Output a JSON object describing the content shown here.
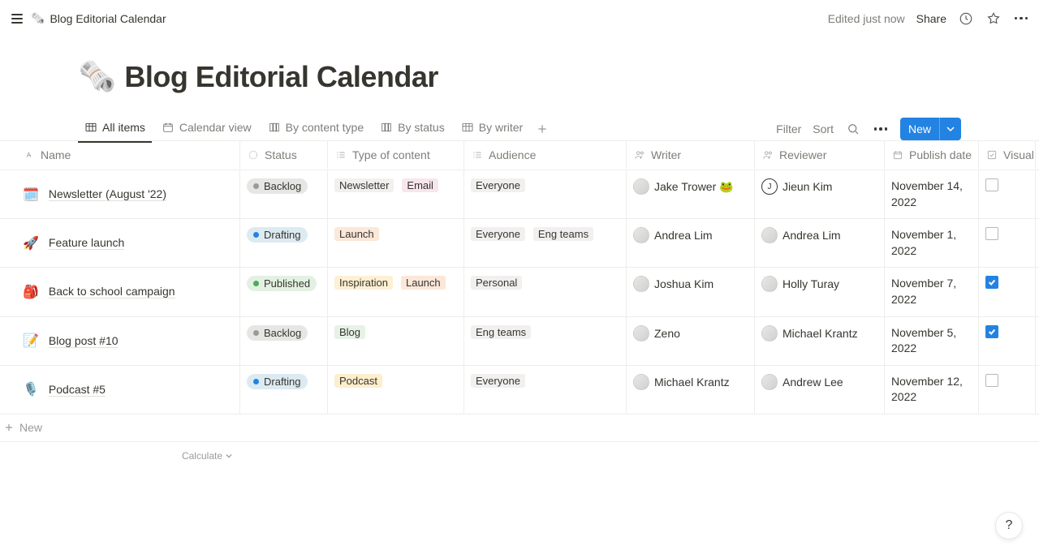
{
  "topbar": {
    "crumb_emoji": "🗞️",
    "crumb_title": "Blog Editorial Calendar",
    "edited": "Edited just now",
    "share": "Share"
  },
  "page": {
    "emoji": "🗞️",
    "title": "Blog Editorial Calendar"
  },
  "views": {
    "items": [
      {
        "label": "All items",
        "active": true
      },
      {
        "label": "Calendar view",
        "active": false
      },
      {
        "label": "By content type",
        "active": false
      },
      {
        "label": "By status",
        "active": false
      },
      {
        "label": "By writer",
        "active": false
      }
    ],
    "filter": "Filter",
    "sort": "Sort",
    "new": "New"
  },
  "columns": {
    "name": "Name",
    "status": "Status",
    "type": "Type of content",
    "audience": "Audience",
    "writer": "Writer",
    "reviewer": "Reviewer",
    "publish": "Publish date",
    "visual": "Visual"
  },
  "rows": [
    {
      "emoji": "🗓️",
      "name": "Newsletter (August '22)",
      "status": {
        "label": "Backlog",
        "tone": "gray"
      },
      "types": [
        {
          "label": "Newsletter",
          "tone": "t-default"
        },
        {
          "label": "Email",
          "tone": "t-pink"
        }
      ],
      "audience": [
        {
          "label": "Everyone",
          "tone": "t-default"
        }
      ],
      "writer": {
        "name": "Jake Trower 🐸",
        "avatar_letter": ""
      },
      "reviewer": {
        "name": "Jieun Kim",
        "avatar_letter": "J",
        "circle": true
      },
      "publish": "November 14, 2022",
      "checked": false
    },
    {
      "emoji": "🚀",
      "name": "Feature launch",
      "status": {
        "label": "Drafting",
        "tone": "blue"
      },
      "types": [
        {
          "label": "Launch",
          "tone": "t-orange"
        }
      ],
      "audience": [
        {
          "label": "Everyone",
          "tone": "t-default"
        },
        {
          "label": "Eng teams",
          "tone": "t-default"
        }
      ],
      "writer": {
        "name": "Andrea Lim",
        "avatar_letter": ""
      },
      "reviewer": {
        "name": "Andrea Lim",
        "avatar_letter": ""
      },
      "publish": "November 1, 2022",
      "checked": false
    },
    {
      "emoji": "🎒",
      "name": "Back to school campaign",
      "status": {
        "label": "Published",
        "tone": "green"
      },
      "types": [
        {
          "label": "Inspiration",
          "tone": "t-peach"
        },
        {
          "label": "Launch",
          "tone": "t-orange"
        }
      ],
      "audience": [
        {
          "label": "Personal",
          "tone": "t-default"
        }
      ],
      "writer": {
        "name": "Joshua Kim",
        "avatar_letter": ""
      },
      "reviewer": {
        "name": "Holly Turay",
        "avatar_letter": ""
      },
      "publish": "November 7, 2022",
      "checked": true
    },
    {
      "emoji": "📝",
      "name": "Blog post #10",
      "status": {
        "label": "Backlog",
        "tone": "gray"
      },
      "types": [
        {
          "label": "Blog",
          "tone": "t-teal"
        }
      ],
      "audience": [
        {
          "label": "Eng teams",
          "tone": "t-default"
        }
      ],
      "writer": {
        "name": "Zeno",
        "avatar_letter": ""
      },
      "reviewer": {
        "name": "Michael Krantz",
        "avatar_letter": ""
      },
      "publish": "November 5, 2022",
      "checked": true
    },
    {
      "emoji": "🎙️",
      "name": "Podcast #5",
      "status": {
        "label": "Drafting",
        "tone": "blue"
      },
      "types": [
        {
          "label": "Podcast",
          "tone": "t-yellow"
        }
      ],
      "audience": [
        {
          "label": "Everyone",
          "tone": "t-default"
        }
      ],
      "writer": {
        "name": "Michael Krantz",
        "avatar_letter": ""
      },
      "reviewer": {
        "name": "Andrew Lee",
        "avatar_letter": ""
      },
      "publish": "November 12, 2022",
      "checked": false
    }
  ],
  "newrow": "New",
  "calculate": "Calculate",
  "help": "?"
}
